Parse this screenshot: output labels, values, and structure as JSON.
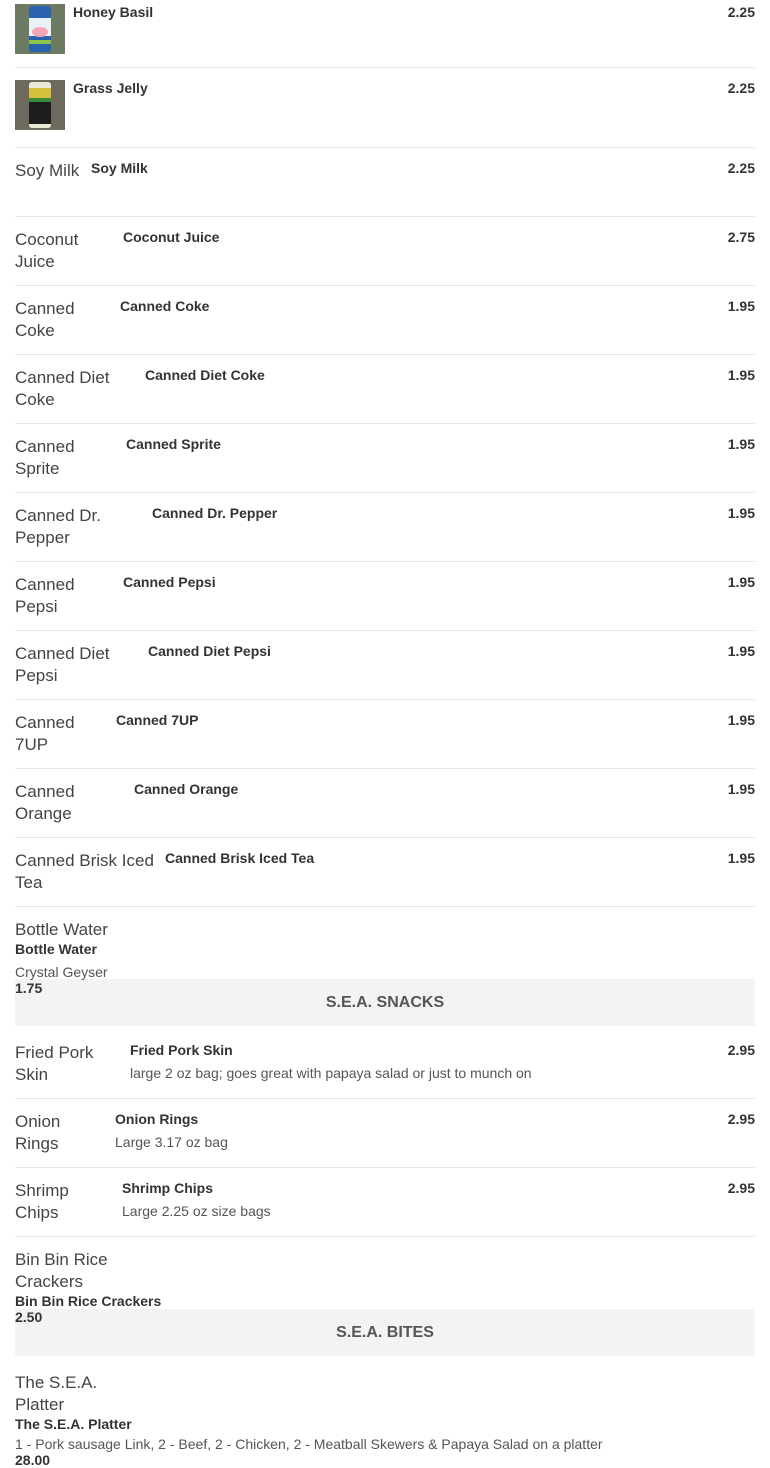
{
  "items_a": [
    {
      "name": "Honey Basil",
      "price": "2.25",
      "thumb": "can-blue"
    },
    {
      "name": "Grass Jelly",
      "price": "2.25",
      "thumb": "can-green"
    },
    {
      "name": "Soy Milk",
      "price": "2.25",
      "alt": "Soy Milk"
    },
    {
      "name": "Coconut Juice",
      "price": "2.75",
      "alt": "Coconut Juice"
    },
    {
      "name": "Canned Coke",
      "price": "1.95",
      "alt": "Canned Coke"
    },
    {
      "name": "Canned Diet Coke",
      "price": "1.95",
      "alt": "Canned Diet Coke"
    },
    {
      "name": "Canned Sprite",
      "price": "1.95",
      "alt": "Canned Sprite"
    },
    {
      "name": "Canned Dr. Pepper",
      "price": "1.95",
      "alt": "Canned Dr. Pepper"
    },
    {
      "name": "Canned Pepsi",
      "price": "1.95",
      "alt": "Canned Pepsi"
    },
    {
      "name": "Canned Diet Pepsi",
      "price": "1.95",
      "alt": "Canned Diet Pepsi"
    },
    {
      "name": "Canned 7UP",
      "price": "1.95",
      "alt": "Canned 7UP"
    },
    {
      "name": "Canned Orange",
      "price": "1.95",
      "alt": "Canned Orange"
    },
    {
      "name": "Canned Brisk Iced Tea",
      "price": "1.95",
      "alt": "Canned Brisk Iced Tea"
    },
    {
      "name": "Bottle Water",
      "price": "1.75",
      "alt": "Bottle Water",
      "desc": "Crystal Geyser"
    }
  ],
  "section_snacks": "S.E.A. SNACKS",
  "items_b": [
    {
      "name": "Fried Pork Skin",
      "price": "2.95",
      "alt": "Fried Pork Skin",
      "desc": "large 2 oz bag; goes great with papaya salad or just to munch on"
    },
    {
      "name": "Onion Rings",
      "price": "2.95",
      "alt": "Onion Rings",
      "desc": "Large 3.17 oz bag"
    },
    {
      "name": "Shrimp Chips",
      "price": "2.95",
      "alt": "Shrimp Chips",
      "desc": "Large 2.25 oz size bags"
    },
    {
      "name": "Bin Bin Rice Crackers",
      "price": "2.50",
      "alt": "Bin Bin Rice Crackers"
    }
  ],
  "section_bites": "S.E.A. BITES",
  "items_c": [
    {
      "name": "The S.E.A. Platter",
      "price": "28.00",
      "alt": "The S.E.A. Platter",
      "desc": "1 - Pork sausage Link, 2 - Beef, 2 - Chicken, 2 - Meatball Skewers & Papaya Salad on a platter"
    }
  ]
}
